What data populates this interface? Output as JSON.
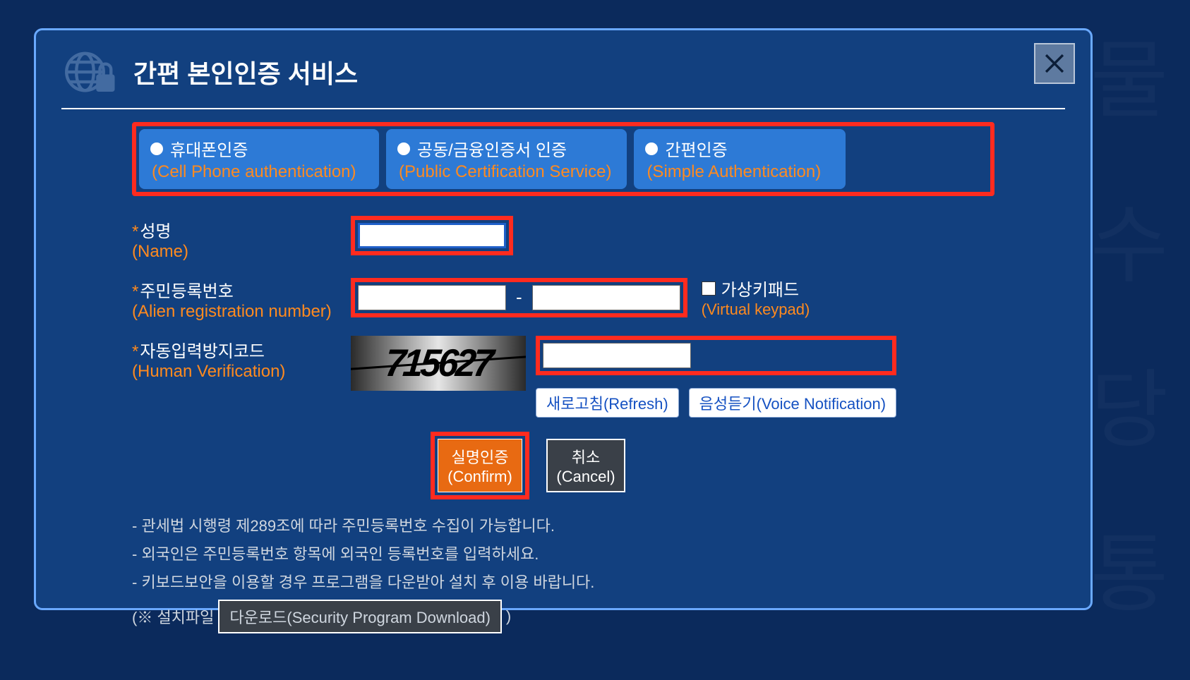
{
  "title": "간편 본인인증 서비스",
  "tabs": [
    {
      "ko": "휴대폰인증",
      "en": "(Cell Phone authentication)"
    },
    {
      "ko": "공동/금융인증서 인증",
      "en": "(Public Certification Service)"
    },
    {
      "ko": "간편인증",
      "en": "(Simple Authentication)"
    }
  ],
  "fields": {
    "name": {
      "ko": "성명",
      "en": "(Name)",
      "value": ""
    },
    "rrn": {
      "ko": "주민등록번호",
      "en": "(Alien registration number)",
      "part1": "",
      "part2": ""
    },
    "vk": {
      "ko": "가상키패드",
      "en": "(Virtual keypad)",
      "checked": false
    },
    "captcha": {
      "ko": "자동입력방지코드",
      "en": "(Human Verification)",
      "image_text": "715627",
      "input": ""
    }
  },
  "buttons": {
    "refresh": "새로고침(Refresh)",
    "voice": "음성듣기(Voice Notification)",
    "confirm_ko": "실명인증",
    "confirm_en": "(Confirm)",
    "cancel_ko": "취소",
    "cancel_en": "(Cancel)"
  },
  "notes": [
    "- 관세법 시행령 제289조에 따라 주민등록번호 수집이 가능합니다.",
    "- 외국인은 주민등록번호 항목에 외국인 등록번호를 입력하세요.",
    "- 키보드보안을 이용할 경우 프로그램을 다운받아 설치 후 이용 바랍니다."
  ],
  "download": {
    "prefix": "(※ 설치파일",
    "label": "다운로드(Security Program Download)",
    "suffix": ")"
  }
}
